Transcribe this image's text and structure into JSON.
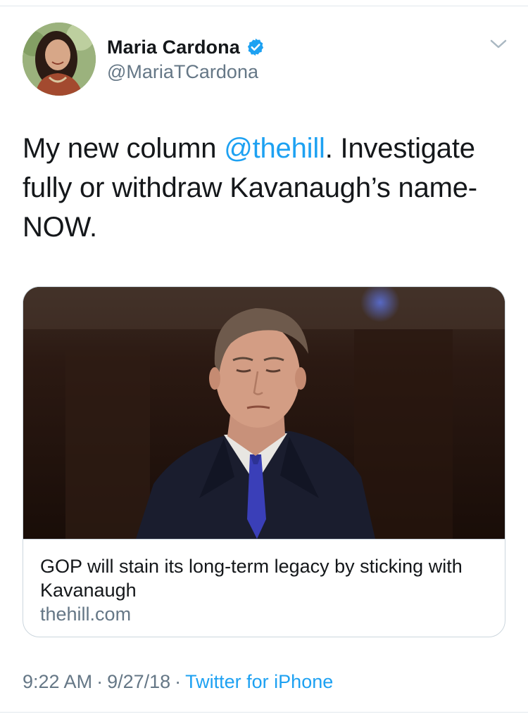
{
  "tweet": {
    "author": {
      "display_name": "Maria Cardona",
      "handle": "@MariaTCardona",
      "verified": true
    },
    "text_parts": {
      "before_mention": "My new column ",
      "mention": "@thehill",
      "after_mention": ". Investigate fully or withdraw Kavanaugh’s name-NOW."
    },
    "card": {
      "title": "GOP will stain its long-term legacy by sticking with Kavanaugh",
      "domain": "thehill.com"
    },
    "meta": {
      "time": "9:22 AM",
      "date": "9/27/18",
      "separator": "·",
      "source": "Twitter for iPhone"
    }
  },
  "icons": {
    "verified": "verified-badge-icon",
    "menu": "chevron-down-icon"
  },
  "colors": {
    "link_blue": "#1da1f2",
    "secondary_text": "#657786",
    "primary_text": "#14171a",
    "border": "#ccd6dd"
  }
}
